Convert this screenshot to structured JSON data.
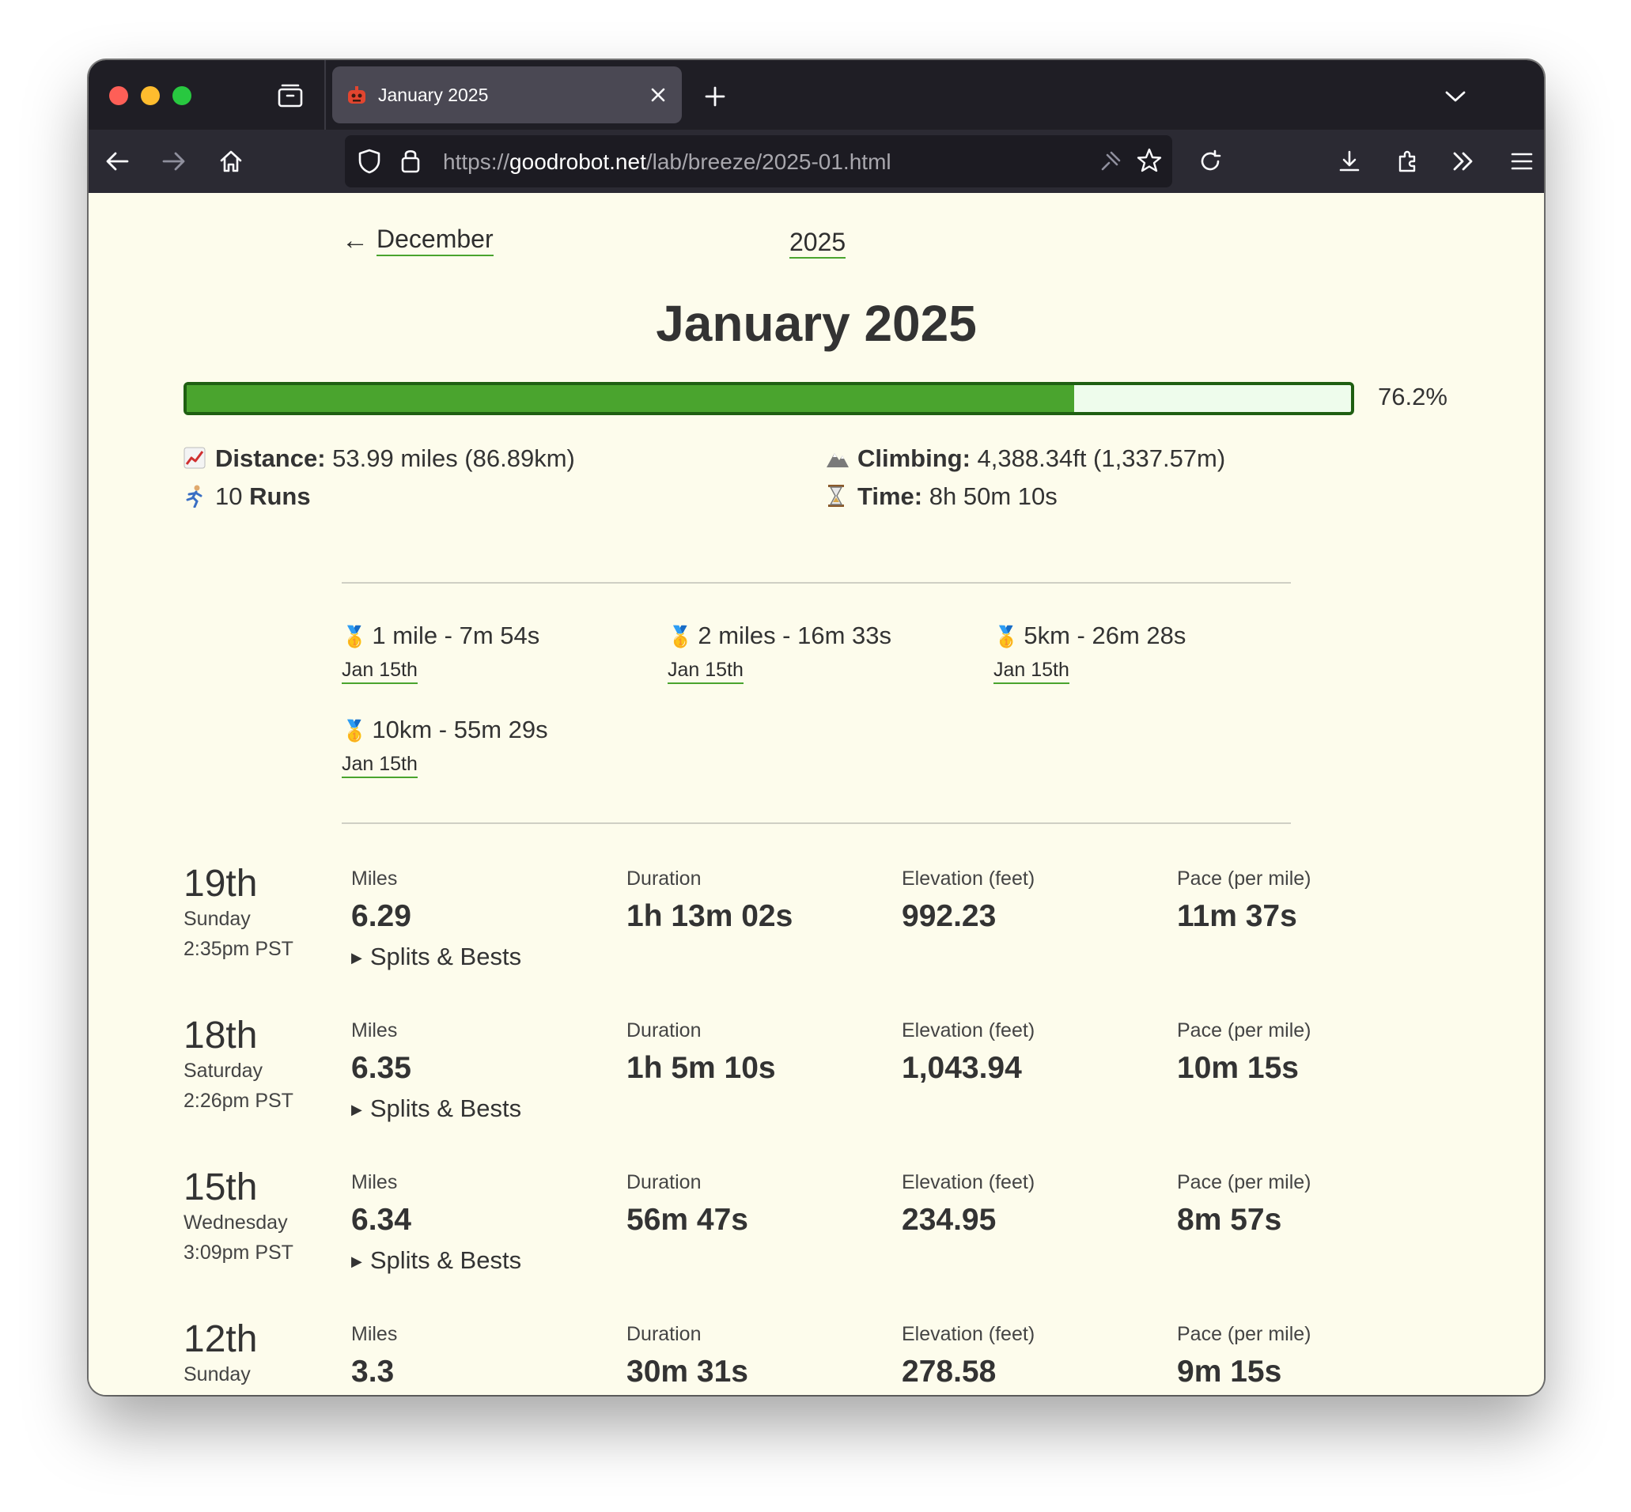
{
  "browser": {
    "tab_title": "January 2025",
    "url_scheme": "https://",
    "url_host": "goodrobot.net",
    "url_path": "/lab/breeze/2025-01.html"
  },
  "nav": {
    "prev_label": "December",
    "year_label": "2025"
  },
  "page": {
    "title": "January 2025",
    "progress_percent": 76.2,
    "progress_label": "76.2%"
  },
  "summary": {
    "distance_label": "Distance:",
    "distance_value": "53.99 miles (86.89km)",
    "runs_count": "10",
    "runs_label": "Runs",
    "climbing_label": "Climbing:",
    "climbing_value": "4,388.34ft (1,337.57m)",
    "time_label": "Time:",
    "time_value": "8h 50m 10s"
  },
  "records": [
    {
      "title": "1 mile - 7m 54s",
      "date": "Jan 15th"
    },
    {
      "title": "2 miles - 16m 33s",
      "date": "Jan 15th"
    },
    {
      "title": "5km - 26m 28s",
      "date": "Jan 15th"
    },
    {
      "title": "10km - 55m 29s",
      "date": "Jan 15th"
    }
  ],
  "labels": {
    "miles": "Miles",
    "duration": "Duration",
    "elevation": "Elevation (feet)",
    "pace": "Pace (per mile)",
    "splits": "Splits & Bests"
  },
  "runs": [
    {
      "day": "19th",
      "weekday": "Sunday",
      "time": "2:35pm PST",
      "miles": "6.29",
      "duration": "1h 13m 02s",
      "elevation": "992.23",
      "pace": "11m 37s"
    },
    {
      "day": "18th",
      "weekday": "Saturday",
      "time": "2:26pm PST",
      "miles": "6.35",
      "duration": "1h 5m 10s",
      "elevation": "1,043.94",
      "pace": "10m 15s"
    },
    {
      "day": "15th",
      "weekday": "Wednesday",
      "time": "3:09pm PST",
      "miles": "6.34",
      "duration": "56m 47s",
      "elevation": "234.95",
      "pace": "8m 57s"
    },
    {
      "day": "12th",
      "weekday": "Sunday",
      "time": "",
      "miles": "3.3",
      "duration": "30m 31s",
      "elevation": "278.58",
      "pace": "9m 15s"
    }
  ],
  "colors": {
    "page_background": "#fdfcec",
    "progress_fill": "#4aa42e",
    "progress_border": "#1f5f12",
    "link_underline": "#4aa42e"
  }
}
